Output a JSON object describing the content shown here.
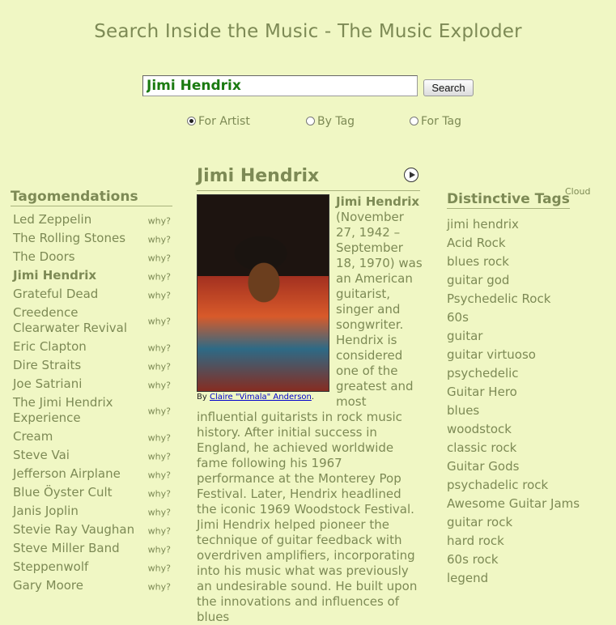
{
  "page": {
    "title": "Search Inside the Music - The Music Exploder"
  },
  "search": {
    "value": "Jimi Hendrix",
    "button_label": "Search"
  },
  "radios": [
    {
      "label": "For Artist",
      "checked": true
    },
    {
      "label": "By Tag",
      "checked": false
    },
    {
      "label": "For Tag",
      "checked": false
    }
  ],
  "tagomendations": {
    "heading": "Tagomendations",
    "why_label": "why?",
    "items": [
      "Led Zeppelin",
      "The Rolling Stones",
      "The Doors",
      "Jimi Hendrix",
      "Grateful Dead",
      "Creedence Clearwater Revival",
      "Eric Clapton",
      "Dire Straits",
      "Joe Satriani",
      "The Jimi Hendrix Experience",
      "Cream",
      "Steve Vai",
      "Jefferson Airplane",
      "Blue Öyster Cult",
      "Janis Joplin",
      "Stevie Ray Vaughan",
      "Steve Miller Band",
      "Steppenwolf",
      "Gary Moore"
    ],
    "current": "Jimi Hendrix"
  },
  "artist": {
    "name": "Jimi Hendrix",
    "photo_credit_prefix": "By ",
    "photo_credit_link": "Claire \"Vimala\" Anderson",
    "photo_credit_suffix": ".",
    "bio_name": "Jimi Hendrix",
    "bio_text": " (November 27, 1942 – September 18, 1970) was an American guitarist, singer and songwriter. Hendrix is considered one of the greatest and most influential guitarists in rock music history. After initial success in England, he achieved worldwide fame following his 1967 performance at the Monterey Pop Festival. Later, Hendrix headlined the iconic 1969 Woodstock Festival. Jimi Hendrix helped pioneer the technique of guitar feedback with overdriven amplifiers, incorporating into his music what was previously an undesirable sound. He built upon the innovations and influences of blues"
  },
  "distinctive_tags": {
    "heading": "Distinctive Tags",
    "cloud_label": "Cloud",
    "items": [
      "jimi hendrix",
      "Acid Rock",
      "blues rock",
      "guitar god",
      "Psychedelic Rock",
      "60s",
      "guitar",
      "guitar virtuoso",
      "psychedelic",
      "Guitar Hero",
      "blues",
      "woodstock",
      "classic rock",
      "Guitar Gods",
      "psychadelic rock",
      "Awesome Guitar Jams",
      "guitar rock",
      "hard rock",
      "60s rock",
      "legend"
    ]
  },
  "colors": {
    "background": "#f0f7c4",
    "text": "#7d8a55",
    "input_text": "#1a7a10",
    "link": "#0000cc"
  },
  "icons": {
    "play": "play-icon"
  }
}
